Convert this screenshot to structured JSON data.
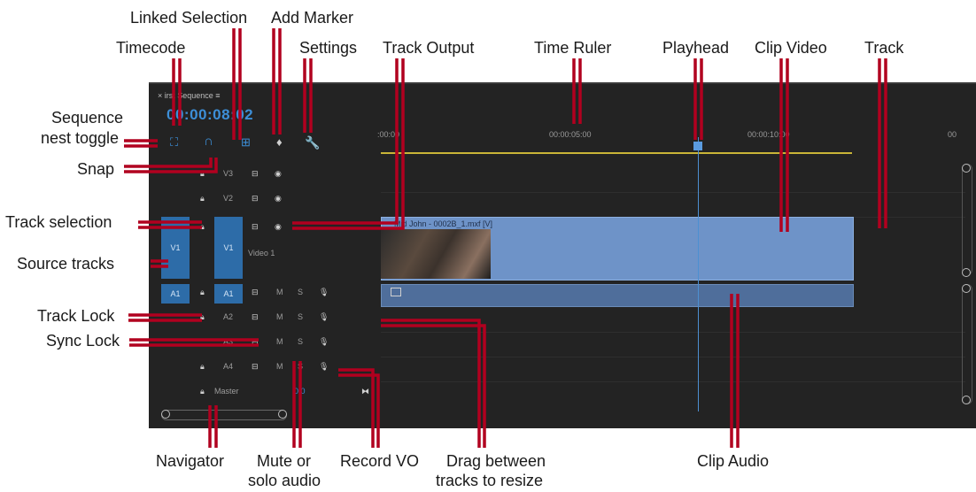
{
  "callouts": {
    "linked_selection": "Linked Selection",
    "add_marker": "Add Marker",
    "timecode": "Timecode",
    "settings": "Settings",
    "track_output": "Track Output",
    "time_ruler": "Time Ruler",
    "playhead": "Playhead",
    "clip_video": "Clip Video",
    "track": "Track",
    "sequence_nest_line1": "Sequence",
    "sequence_nest_line2": "nest toggle",
    "snap": "Snap",
    "track_selection": "Track selection",
    "source_tracks": "Source tracks",
    "track_lock": "Track Lock",
    "sync_lock": "Sync Lock",
    "navigator": "Navigator",
    "mute_solo_line1": "Mute or",
    "mute_solo_line2": "solo audio",
    "record_vo": "Record VO",
    "drag_resize_line1": "Drag between",
    "drag_resize_line2": "tracks to resize",
    "clip_audio": "Clip Audio"
  },
  "panel": {
    "tab_label": "× irst Sequence ≡",
    "timecode_value": "00:00:08:02",
    "ruler_labels": [
      ":00:00",
      "00:00:05:00",
      "00:00:10:00",
      "00"
    ],
    "video_tracks": [
      "V3",
      "V2",
      "V1"
    ],
    "audio_tracks": [
      "A1",
      "A2",
      "A3",
      "A4"
    ],
    "video1_name": "Video 1",
    "master_label": "Master",
    "master_value": "0.0",
    "source_v": "V1",
    "source_a": "A1",
    "mute_label": "M",
    "solo_label": "S",
    "clip_name": "Mid John - 0002B_1.mxf [V]"
  },
  "colors": {
    "panel_bg": "#232323",
    "accent_blue": "#3d8fd8",
    "clip_video": "#6e93c8",
    "clip_audio": "#4f6e9b",
    "leader_red": "#b1001f",
    "ruler_yellow": "#c9b537"
  },
  "icons": [
    "sequence-nest-icon",
    "snap-icon",
    "linked-selection-icon",
    "add-marker-icon",
    "settings-wrench-icon",
    "lock-icon",
    "eye-icon",
    "track-output-icon",
    "mic-icon"
  ]
}
